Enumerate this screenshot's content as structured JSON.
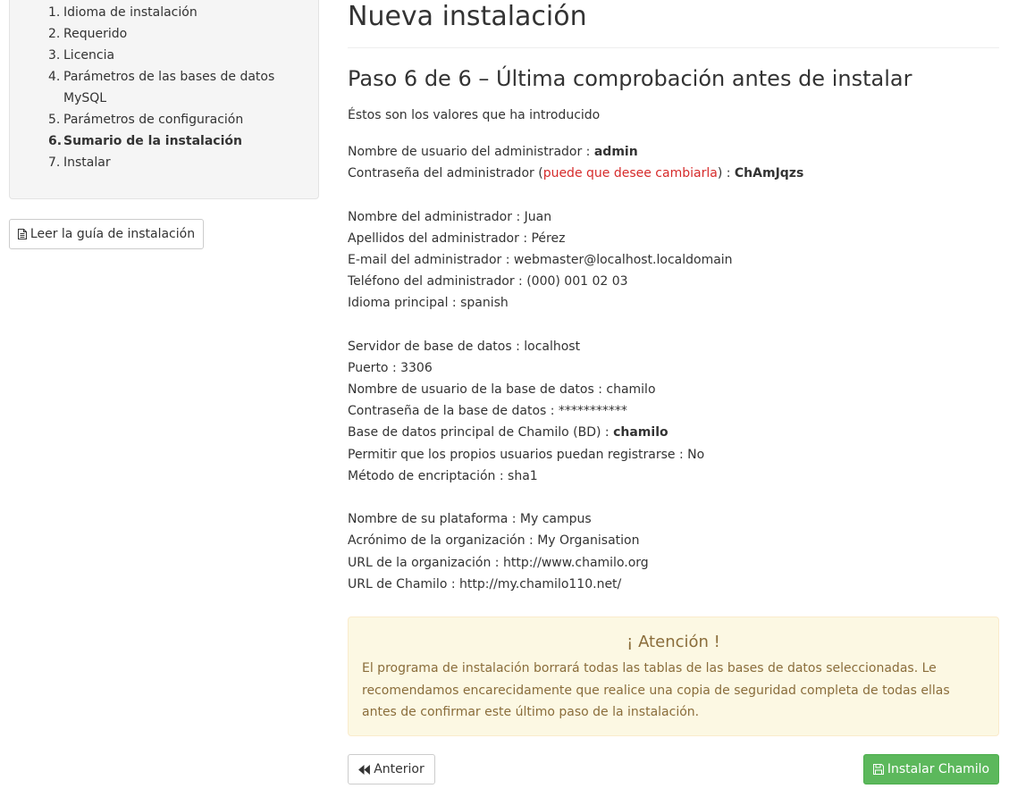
{
  "sidebar": {
    "steps": [
      {
        "num": "1.",
        "label": "Idioma de instalación"
      },
      {
        "num": "2.",
        "label": "Requerido"
      },
      {
        "num": "3.",
        "label": "Licencia"
      },
      {
        "num": "4.",
        "label": "Parámetros de las bases de datos MySQL"
      },
      {
        "num": "5.",
        "label": "Parámetros de configuración"
      },
      {
        "num": "6.",
        "label": "Sumario de la instalación"
      },
      {
        "num": "7.",
        "label": "Instalar"
      }
    ],
    "active_step": 6,
    "guide_button": "Leer la guía de instalación"
  },
  "main": {
    "page_title": "Nueva instalación",
    "step_title": "Paso 6 de 6 – Última comprobación antes de instalar",
    "intro": "Éstos son los valores que ha introducido",
    "admin": {
      "login_label": "Nombre de usuario del administrador : ",
      "login_value": "admin",
      "password_label": "Contraseña del administrador (",
      "password_change": "puede que desee cambiarla",
      "password_label_end": ") : ",
      "password_value": "ChAmJqzs",
      "firstname": "Nombre del administrador : Juan",
      "lastname": "Apellidos del administrador : Pérez",
      "email": "E-mail del administrador : webmaster@localhost.localdomain",
      "phone": "Teléfono del administrador : (000) 001 02 03",
      "language": "Idioma principal : spanish"
    },
    "database": {
      "host": "Servidor de base de datos : localhost",
      "port": "Puerto : 3306",
      "user": "Nombre de usuario de la base de datos : chamilo",
      "password": "Contraseña de la base de datos : ***********",
      "main_db_label": "Base de datos principal de Chamilo (BD) : ",
      "main_db_value": "chamilo",
      "self_register": "Permitir que los propios usuarios puedan registrarse : No",
      "encryption": "Método de encriptación : sha1"
    },
    "platform": {
      "name": "Nombre de su plataforma : My campus",
      "org_acronym": "Acrónimo de la organización : My Organisation",
      "org_url": "URL de la organización : http://www.chamilo.org",
      "chamilo_url": "URL de Chamilo : http://my.chamilo110.net/"
    },
    "alert": {
      "title": "¡ Atención !",
      "text": "El programa de instalación borrará todas las tablas de las bases de datos seleccionadas. Le recomendamos encarecidamente que realice una copia de seguridad completa de todas ellas antes de confirmar este último paso de la instalación."
    },
    "buttons": {
      "previous": "Anterior",
      "install": "Instalar Chamilo"
    }
  },
  "colors": {
    "warning_red": "#d62b2b",
    "alert_bg": "#fcf8e3",
    "alert_text": "#8a6d3b",
    "install_green": "#5cb85c"
  },
  "icons": {
    "guide": "file-text-icon",
    "previous": "backward-icon",
    "install": "floppy-disk-icon"
  }
}
